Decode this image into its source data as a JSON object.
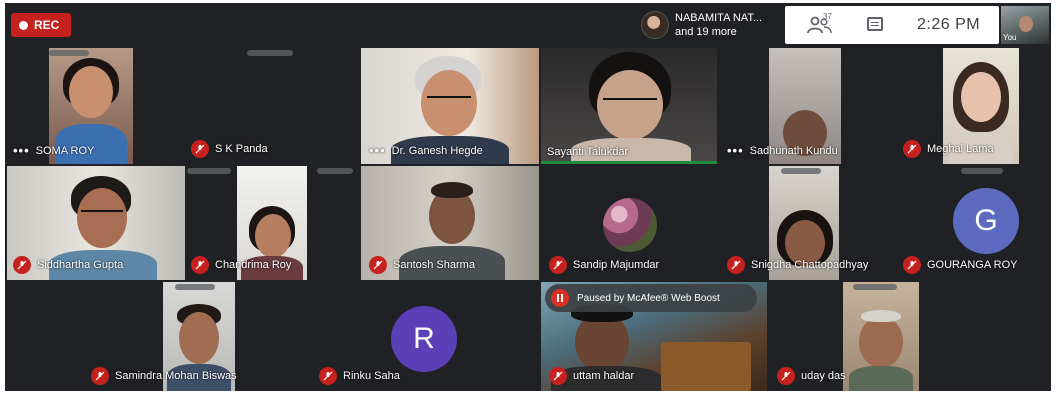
{
  "rec_label": "REC",
  "presenter": {
    "name": "NABAMITA NAT...",
    "more": "and 19 more"
  },
  "tray": {
    "people_count": "37",
    "time": "2:26 PM"
  },
  "self_view_label": "You",
  "paused_banner": "Paused by McAfee® Web Boost",
  "participants": [
    {
      "name": "SOMA ROY",
      "muted": false,
      "more_dots": "•••"
    },
    {
      "name": "S K Panda",
      "muted": true
    },
    {
      "name": "Dr. Ganesh Hegde",
      "muted": false,
      "more_dots": "•••"
    },
    {
      "name": "Sayanti Talukdar",
      "muted": false,
      "speaking": true
    },
    {
      "name": "Sadhunath Kundu",
      "muted": false,
      "more_dots": "•••"
    },
    {
      "name": "Meghal Lama",
      "muted": true
    },
    {
      "name": "Siddhartha Gupta",
      "muted": true
    },
    {
      "name": "Chandrima Roy",
      "muted": true
    },
    {
      "name": "Santosh Sharma",
      "muted": true
    },
    {
      "name": "Sandip Majumdar",
      "muted": true
    },
    {
      "name": "Snigdha Chattopadhyay",
      "muted": true
    },
    {
      "name": "GOURANGA ROY",
      "muted": true,
      "initial": "G",
      "avatar_color": "#5c6bc0"
    },
    {
      "name": "Samindra Mohan Biswas",
      "muted": true
    },
    {
      "name": "Rinku Saha",
      "muted": true,
      "initial": "R",
      "avatar_color": "#5b3fb6"
    },
    {
      "name": "uttam haldar",
      "muted": true
    },
    {
      "name": "uday das",
      "muted": true
    }
  ],
  "colors": {
    "mic_off": "#c5221f",
    "tile_bg": "#3c4043",
    "meeting_bg": "#202124",
    "speaking": "#1e8e3e"
  },
  "icons": {
    "mic_off": "mic-off-icon",
    "people": "people-icon",
    "chat": "chat-icon",
    "pause": "pause-icon",
    "record": "record-dot-icon"
  }
}
